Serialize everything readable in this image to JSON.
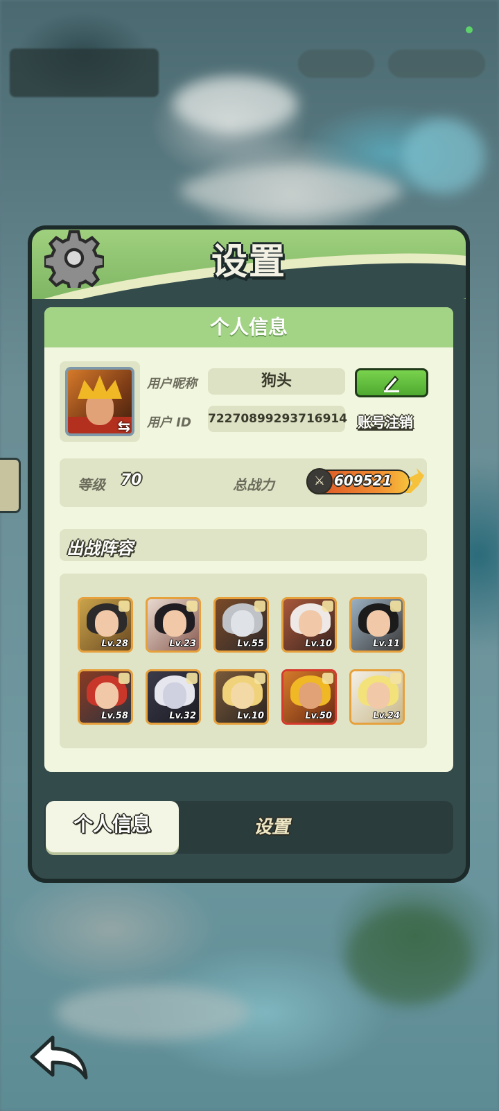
{
  "header": {
    "title": "设置"
  },
  "profile_section": {
    "title": "个人信息",
    "nickname_label": "用户昵称",
    "nickname_value": "狗头",
    "id_label": "用户 ID",
    "id_value": "72270899293716914",
    "logout_label": "账号注销"
  },
  "stats": {
    "level_label": "等级",
    "level_value": "70",
    "power_label": "总战力",
    "power_value": "609521"
  },
  "lineup": {
    "title": "出战阵容",
    "heroes": [
      {
        "level": "Lv.28"
      },
      {
        "level": "Lv.23"
      },
      {
        "level": "Lv.55"
      },
      {
        "level": "Lv.10"
      },
      {
        "level": "Lv.11"
      },
      {
        "level": "Lv.58"
      },
      {
        "level": "Lv.32"
      },
      {
        "level": "Lv.10"
      },
      {
        "level": "Lv.50"
      },
      {
        "level": "Lv.24"
      }
    ]
  },
  "tabs": {
    "profile": "个人信息",
    "settings": "设置"
  },
  "icons": {
    "gear": "gear-icon",
    "edit": "pencil-icon",
    "swap": "swap-icon",
    "power": "swords-icon",
    "back": "back-arrow-icon"
  },
  "colors": {
    "header_green": "#9fd07e",
    "button_green": "#4ea92f",
    "power_orange": "#f18e32",
    "frame_orange": "#e6a03c",
    "frame_red": "#d63a2c"
  }
}
